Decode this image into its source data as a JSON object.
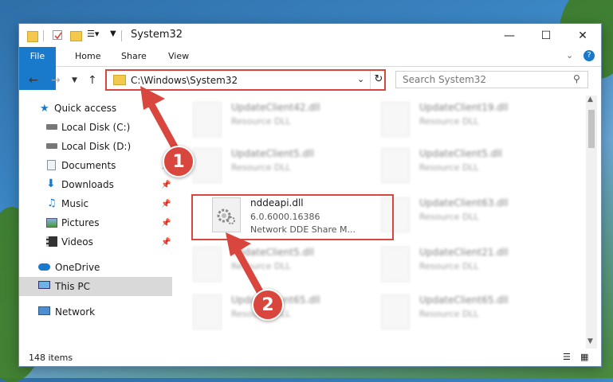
{
  "window": {
    "title": "System32"
  },
  "ribbon": {
    "tabs": [
      "File",
      "Home",
      "Share",
      "View"
    ]
  },
  "address": {
    "path": "C:\\Windows\\System32"
  },
  "search": {
    "placeholder": "Search System32"
  },
  "nav": {
    "items": [
      {
        "label": "Quick access",
        "icon": "star-icon"
      },
      {
        "label": "Local Disk (C:)",
        "icon": "drive-icon"
      },
      {
        "label": "Local Disk (D:)",
        "icon": "drive-icon"
      },
      {
        "label": "Documents",
        "icon": "documents-icon",
        "pinned": true
      },
      {
        "label": "Downloads",
        "icon": "downloads-icon",
        "pinned": true
      },
      {
        "label": "Music",
        "icon": "music-icon",
        "pinned": true
      },
      {
        "label": "Pictures",
        "icon": "pictures-icon",
        "pinned": true
      },
      {
        "label": "Videos",
        "icon": "videos-icon",
        "pinned": true
      },
      {
        "label": "OneDrive",
        "icon": "cloud-icon"
      },
      {
        "label": "This PC",
        "icon": "computer-icon",
        "selected": true
      },
      {
        "label": "Network",
        "icon": "network-icon"
      }
    ]
  },
  "files": [
    {
      "name": "UpdateClient42.dll",
      "desc": "Resource DLL"
    },
    {
      "name": "UpdateClient19.dll",
      "desc": "Resource DLL"
    },
    {
      "name": "UpdateClient5.dll",
      "desc": "Resource DLL"
    },
    {
      "name": "UpdateClient5.dll",
      "desc": "Resource DLL"
    },
    {
      "name": "nddeapi.dll",
      "version": "6.0.6000.16386",
      "desc": "Network DDE Share M..."
    },
    {
      "name": "UpdateClient63.dll",
      "desc": "Resource DLL"
    },
    {
      "name": "UpdateClient5.dll",
      "desc": "Resource DLL"
    },
    {
      "name": "UpdateClient21.dll",
      "desc": "Resource DLL"
    },
    {
      "name": "UpdateClient65.dll",
      "desc": "Resource DLL"
    },
    {
      "name": "UpdateClient65.dll",
      "desc": "Resource DLL"
    }
  ],
  "status": {
    "count": "148 items"
  },
  "callouts": [
    "1",
    "2"
  ],
  "colors": {
    "accent": "#1979ca",
    "highlight": "#d9463d",
    "selected": "#d9d9d9"
  }
}
